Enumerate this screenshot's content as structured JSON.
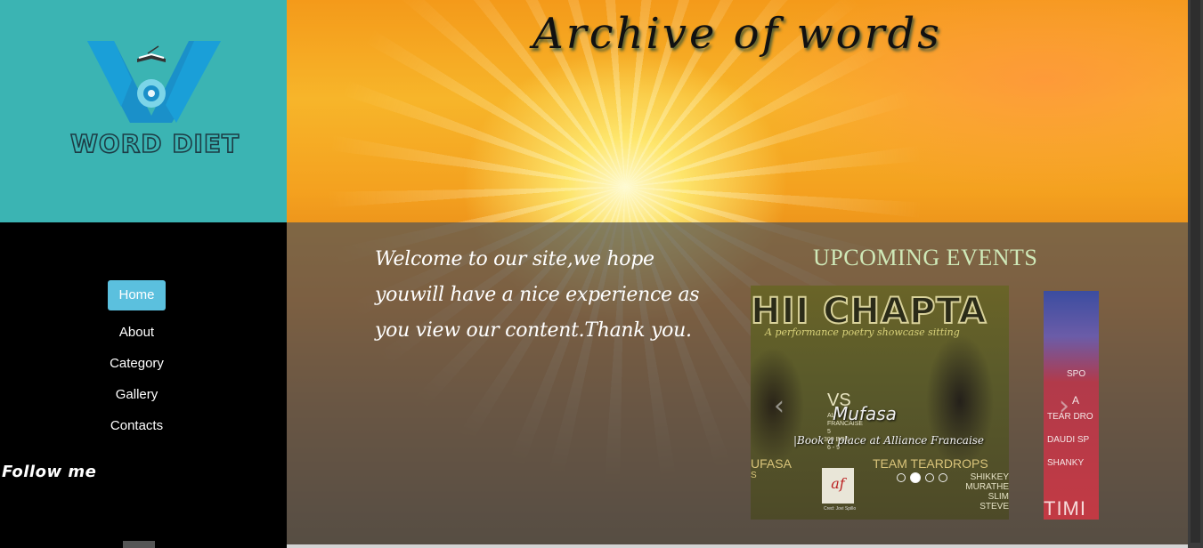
{
  "header": {
    "site_title": "Archive of words",
    "logo_text": "WORD DIET"
  },
  "nav": {
    "items": [
      {
        "label": "Home",
        "active": true
      },
      {
        "label": "About",
        "active": false
      },
      {
        "label": "Category",
        "active": false
      },
      {
        "label": "Gallery",
        "active": false
      },
      {
        "label": "Contacts",
        "active": false
      }
    ],
    "follow_label": "Follow me"
  },
  "main": {
    "welcome_text": "Welcome to our site,we hope youwill have a nice experience as you view our content.Thank you."
  },
  "events": {
    "title": "UPCOMING EVENTS",
    "carousel": {
      "slide1": {
        "poster_title": "HII CHAPTA",
        "poster_tagline": "A performance poetry showcase sitting",
        "vs": "VS",
        "left_team": "UFASA",
        "left_sub": "S",
        "right_team": "TEAM TEARDROPS",
        "names": [
          "SHIKKEY",
          "MURATHE",
          "SLIM STEVE"
        ],
        "venue_lines": [
          "AL",
          "FRANCAISE",
          "5",
          "300 BOB",
          "6 - 9"
        ],
        "sponsor_logo": "af",
        "sponsor_small": "Cred: Jovi Spillo",
        "caption_title": "Mufasa",
        "caption_text": "|Book a place at Alliance Francaise"
      },
      "slide2": {
        "lines": [
          "SPO",
          "A",
          "TEAR DRO",
          "DAUDI SP",
          "SHANKY"
        ],
        "footer": "TIMI"
      },
      "indicator_count": 4,
      "active_index": 1,
      "prev_icon": "chevron-left-icon",
      "next_icon": "chevron-right-icon"
    }
  },
  "colors": {
    "logo_bg": "#3bb4b3",
    "nav_bg": "#000000",
    "active_nav": "#5bc0de",
    "events_title": "#cfe9b8"
  }
}
